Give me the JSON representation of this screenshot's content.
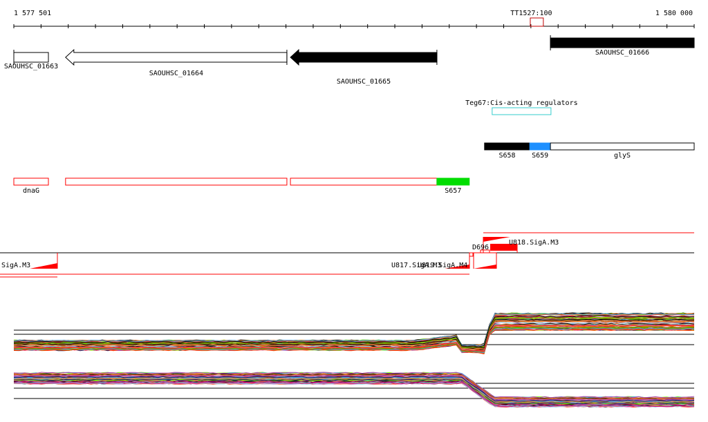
{
  "region": {
    "start": 1577501,
    "end": 1580000,
    "start_label": "1 577 501",
    "end_label": "1 580 000",
    "tick_count": 25
  },
  "terminator": {
    "label": "TT1527:100",
    "start": 1579398,
    "end": 1579446,
    "color": "#c00000"
  },
  "genes": [
    {
      "label": "SAOUHSC_01663",
      "start": 1577501,
      "end": 1577628,
      "strand": "+",
      "fill": "#ffffff"
    },
    {
      "label": "SAOUHSC_01664",
      "start": 1577691,
      "end": 1578504,
      "strand": "-",
      "fill": "#ffffff"
    },
    {
      "label": "SAOUHSC_01665",
      "start": 1578517,
      "end": 1579055,
      "strand": "-",
      "fill": "#000000"
    },
    {
      "label": "SAOUHSC_01666",
      "start": 1579472,
      "end": 1580000,
      "strand": "+",
      "fill": "#000000"
    }
  ],
  "regulator": {
    "label": "Teg67:Cis-acting regulators",
    "start": 1579258,
    "end": 1579474,
    "color": "#33cccc"
  },
  "segments": [
    {
      "label": "S658",
      "start": 1579230,
      "end": 1579396,
      "fill": "#000000",
      "stroke": "#000000"
    },
    {
      "label": "S659",
      "start": 1579396,
      "end": 1579472,
      "fill": "#1e90ff",
      "stroke": "#1e90ff"
    },
    {
      "label": "glyS",
      "start": 1579472,
      "end": 1580000,
      "fill": "#ffffff",
      "stroke": "#000000"
    }
  ],
  "transcripts": [
    {
      "label": "dnaG",
      "start": 1577501,
      "end": 1577628,
      "fill": "#ffffff",
      "stroke": "#ff0000"
    },
    {
      "label": "",
      "start": 1577691,
      "end": 1578504,
      "fill": "#ffffff",
      "stroke": "#ff0000"
    },
    {
      "label": "",
      "start": 1578517,
      "end": 1579055,
      "fill": "#ffffff",
      "stroke": "#ff0000"
    },
    {
      "label": "S657",
      "start": 1579055,
      "end": 1579174,
      "fill": "#00dd00",
      "stroke": "#00dd00"
    }
  ],
  "promoters": {
    "color": "#ff0000",
    "labels": [
      {
        "text": "SigA.M3",
        "name": "promoter-siga-m3-label"
      },
      {
        "text": "U817.SigA.M3",
        "name": "promoter-u817-label"
      },
      {
        "text": "U819.SigA.M4",
        "name": "promoter-u819-label"
      },
      {
        "text": "D696",
        "name": "promoter-d696-label"
      },
      {
        "text": "U818.SigA.M3",
        "name": "promoter-u818-label"
      }
    ]
  },
  "expression": {
    "series_count": 60,
    "palette": [
      "#e6194b",
      "#f58231",
      "#ff6347",
      "#c0504d",
      "#8b4513",
      "#9a9a2a",
      "#808000",
      "#7fff00",
      "#66cc00",
      "#87ceeb",
      "#4fa3e0",
      "#aa44aa",
      "#c71585",
      "#dda0dd",
      "#e9967a",
      "#b8860b",
      "#1a1a60",
      "#cd853f",
      "#ff4500",
      "#d2691e"
    ]
  }
}
